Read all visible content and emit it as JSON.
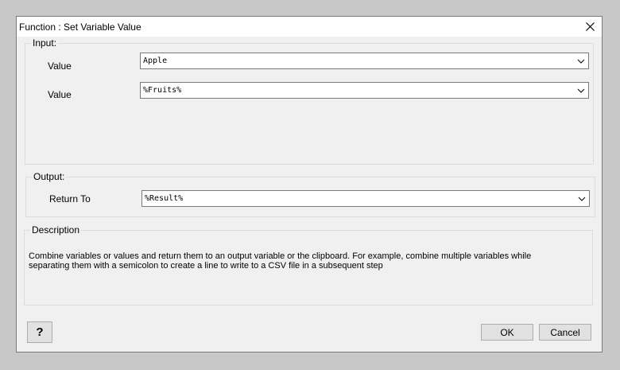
{
  "window": {
    "title": "Function : Set Variable Value"
  },
  "input_group": {
    "label": "Input:",
    "fields": [
      {
        "label": "Value",
        "value": "Apple"
      },
      {
        "label": "Value",
        "value": "%Fruits%"
      }
    ]
  },
  "output_group": {
    "label": "Output:",
    "field": {
      "label": "Return To",
      "value": "%Result%"
    }
  },
  "description": {
    "label": "Description",
    "line1": "Combine variables or values and return them to an output variable or the clipboard. For example, combine multiple variables while",
    "line2": "separating them with a semicolon to create a line to write to a CSV file in a subsequent step"
  },
  "buttons": {
    "help": "?",
    "ok": "OK",
    "cancel": "Cancel"
  },
  "icons": {
    "close": "close-icon",
    "dropdown": "chevron-down-icon"
  }
}
